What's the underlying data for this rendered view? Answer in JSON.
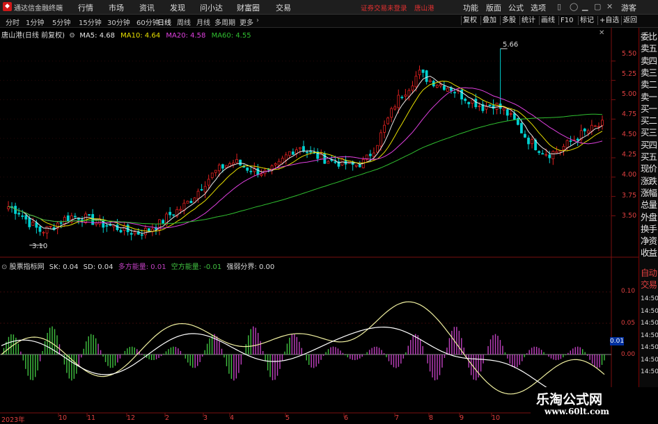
{
  "app": {
    "title": "通达信金融终端",
    "notice": "证券交易未登录",
    "stock_in_title": "唐山港"
  },
  "menu": [
    "行情",
    "市场",
    "资讯",
    "发现",
    "问小达",
    "财富圈",
    "交易"
  ],
  "right_menu": [
    "功能",
    "版面",
    "公式",
    "选项",
    "游客"
  ],
  "periods": [
    "分时",
    "1分钟",
    "5分钟",
    "15分钟",
    "30分钟",
    "60分钟",
    "日线",
    "周线",
    "月线",
    "多周期",
    "更多"
  ],
  "active_period": "日线",
  "toolbar_right": [
    "复权",
    "叠加",
    "多股",
    "统计",
    "画线",
    "F10",
    "标记",
    "+自选",
    "返回"
  ],
  "main_legend": {
    "name": "唐山港(日线 前复权)",
    "ma5": "MA5: 4.68",
    "ma10": "MA10: 4.64",
    "ma20": "MA20: 4.58",
    "ma60": "MA60: 4.55"
  },
  "indicator_legend": {
    "name": "股票指标网",
    "sk": "SK: 0.04",
    "sd": "SD: 0.04",
    "duo_label": "多方能量:",
    "duo_val": "0.01",
    "kong_label": "空方能量:",
    "kong_val": "-0.01",
    "qr_label": "强弱分界:",
    "qr_val": "0.00"
  },
  "price_axis": [
    "5.50",
    "5.25",
    "5.00",
    "4.75",
    "4.50",
    "4.25",
    "4.00",
    "3.75",
    "3.50"
  ],
  "indicator_axis": [
    "0.10",
    "0.05",
    "0.00"
  ],
  "indicator_value_box": "0.01",
  "annotations": {
    "high": "5.66",
    "low": "3.10"
  },
  "x_labels": [
    "2023年",
    "10",
    "11",
    "12",
    "2",
    "3",
    "4",
    "5",
    "6",
    "7",
    "8",
    "9",
    "10"
  ],
  "side_panel": [
    "委比",
    "卖五",
    "卖四",
    "卖三",
    "卖二",
    "卖一",
    "买一",
    "买二",
    "买三",
    "买四",
    "买五",
    "现价",
    "涨跌",
    "涨幅",
    "总量",
    "外盘",
    "换手",
    "净资",
    "收益"
  ],
  "side_panel2": [
    "自动",
    "交易"
  ],
  "side_times": [
    "14:50",
    "14:50",
    "14:50",
    "14:50",
    "14:50",
    "14:50",
    "14:50"
  ],
  "colors": {
    "up": "#e02020",
    "down": "#00d0d0",
    "ma5": "#e8e8e8",
    "ma10": "#e8e000",
    "ma20": "#e040e0",
    "ma60": "#30c030",
    "duo": "#c040c0",
    "kong": "#40c040"
  },
  "watermark": {
    "cn": "乐淘公式网",
    "url": "www.60lt.com"
  },
  "chart_data": {
    "type": "candlestick",
    "symbol": "唐山港",
    "y_range": [
      3.1,
      5.66
    ],
    "high": 5.66,
    "low": 3.1,
    "close_approx": [
      3.62,
      3.55,
      3.4,
      3.3,
      3.35,
      3.45,
      3.5,
      3.48,
      3.42,
      3.38,
      3.35,
      3.3,
      3.28,
      3.32,
      3.4,
      3.52,
      3.6,
      3.72,
      3.9,
      4.05,
      4.15,
      4.2,
      4.12,
      4.08,
      4.05,
      4.15,
      4.32,
      4.4,
      4.3,
      4.25,
      4.2,
      4.18,
      4.15,
      4.2,
      4.4,
      4.7,
      5.0,
      5.15,
      5.35,
      5.25,
      5.2,
      5.15,
      5.05,
      4.98,
      4.9,
      4.95,
      4.85,
      4.7,
      4.5,
      4.38,
      4.3,
      4.35,
      4.45,
      4.55,
      4.62,
      4.68
    ]
  }
}
